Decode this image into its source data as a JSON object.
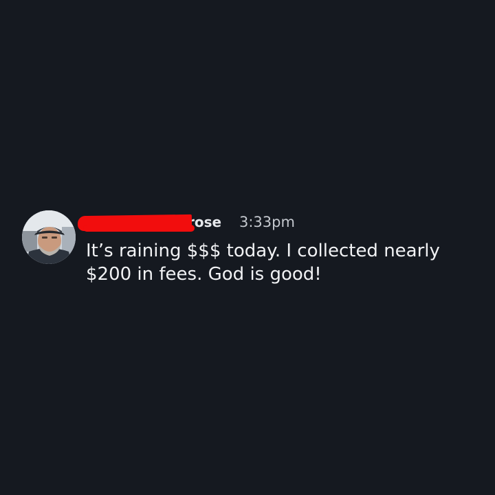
{
  "message": {
    "username_visible": "rose",
    "timestamp": "3:33pm",
    "text": "It’s raining $$$ today. I collected nearly $200 in fees. God is good!"
  },
  "colors": {
    "background": "#151920",
    "redaction": "#f20d0d",
    "text": "#f1f2f4",
    "timestamp": "#c4c8ce"
  }
}
